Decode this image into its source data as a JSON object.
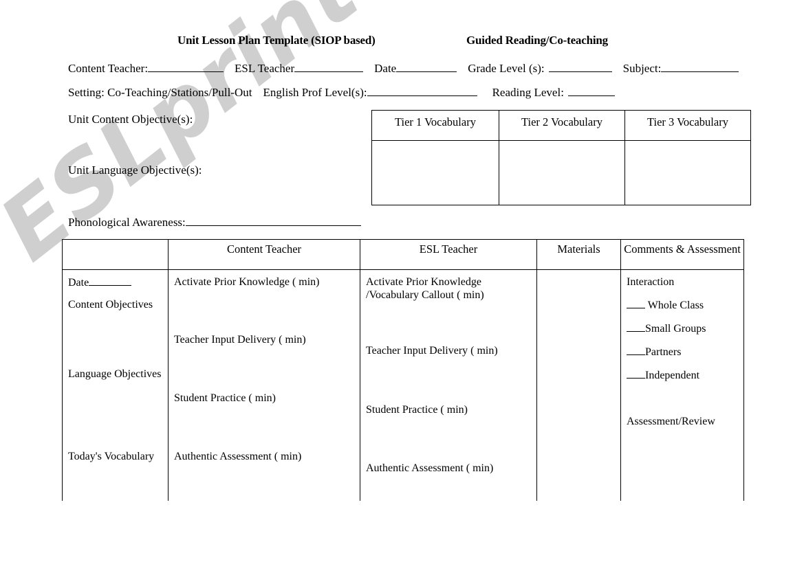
{
  "document": {
    "title_left": "Unit Lesson Plan Template (SIOP based)",
    "title_right": "Guided Reading/Co-teaching",
    "watermark": "ESLprintables.com"
  },
  "info_fields": {
    "content_teacher": "Content Teacher:",
    "esl_teacher": "ESL Teacher",
    "date": "Date",
    "grade_level": "Grade Level (s):",
    "subject": "Subject:",
    "setting": "Setting: Co-Teaching/Stations/Pull-Out",
    "english_prof_level": "English Prof Level(s):",
    "reading_level": "Reading Level:"
  },
  "objectives": {
    "unit_content_objective": "Unit Content Objective(s):",
    "unit_language_objective": "Unit Language Objective(s):",
    "phonological_awareness": "Phonological Awareness:"
  },
  "vocab_table": {
    "headers": [
      "Tier 1 Vocabulary",
      "Tier 2 Vocabulary",
      "Tier 3 Vocabulary"
    ],
    "body": [
      "",
      "",
      ""
    ]
  },
  "main_table": {
    "headers": [
      "",
      "Content Teacher",
      "ESL Teacher",
      "Materials",
      "Comments & Assessment"
    ],
    "col1": {
      "date": "Date",
      "content_objectives": "Content Objectives",
      "language_objectives": "Language Objectives",
      "todays_vocabulary": "Today's Vocabulary"
    },
    "col2": {
      "activate_prior_knowledge": "Activate Prior Knowledge (      min)",
      "teacher_input_delivery": "Teacher Input Delivery (      min)",
      "student_practice": "Student Practice (      min)",
      "authentic_assessment": "Authentic Assessment (      min)"
    },
    "col3": {
      "activate_prior_knowledge": "Activate Prior Knowledge /Vocabulary Callout     (      min)",
      "activate_prior_knowledge_line1": "Activate Prior Knowledge",
      "activate_prior_knowledge_line2": "/Vocabulary Callout     (      min)",
      "teacher_input_delivery": "Teacher Input Delivery (      min)",
      "student_practice": "Student Practice (      min)",
      "authentic_assessment": "Authentic Assessment (      min)"
    },
    "col4": {
      "materials": ""
    },
    "col5": {
      "interaction": "Interaction",
      "whole_class": "Whole Class",
      "small_groups": "Small Groups",
      "partners": "Partners",
      "independent": "Independent",
      "assessment_review": "Assessment/Review"
    }
  }
}
